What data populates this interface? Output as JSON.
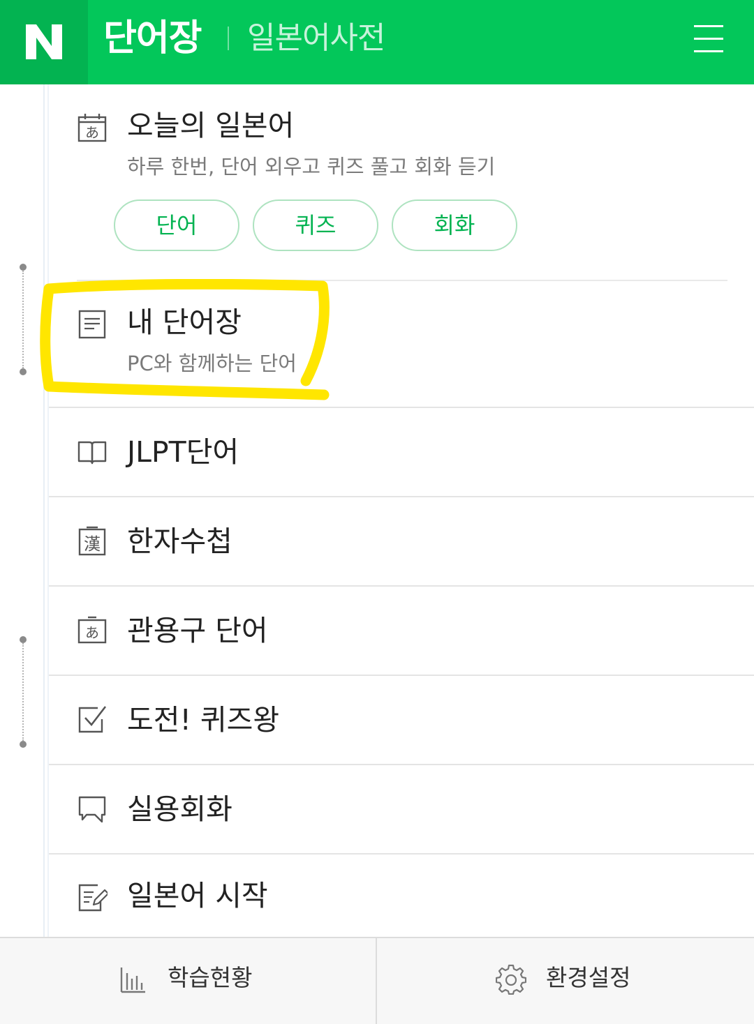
{
  "header": {
    "logo": "N",
    "title": "단어장",
    "subtitle": "일본어사전",
    "menu_icon": "hamburger-menu-icon",
    "background_color": "#03c75a"
  },
  "today": {
    "icon": "calendar-hiragana-icon",
    "icon_glyph": "あ",
    "title": "오늘의 일본어",
    "subtitle": "하루 한번, 단어 외우고 퀴즈 풀고 회화 듣기",
    "buttons": [
      "단어",
      "퀴즈",
      "회화"
    ]
  },
  "menu": [
    {
      "icon": "notebook-icon",
      "label": "내 단어장",
      "subtitle": "PC와 함께하는 단어"
    },
    {
      "icon": "open-book-icon",
      "label": "JLPT단어"
    },
    {
      "icon": "kanji-card-icon",
      "icon_glyph": "漢",
      "label": "한자수첩"
    },
    {
      "icon": "hiragana-card-icon",
      "icon_glyph": "あ",
      "label": "관용구 단어"
    },
    {
      "icon": "checkbox-icon",
      "label": "도전! 퀴즈왕"
    },
    {
      "icon": "speech-bubble-icon",
      "label": "실용회화"
    },
    {
      "icon": "edit-document-icon",
      "label": "일본어 시작"
    }
  ],
  "bottom": {
    "left": {
      "icon": "bar-chart-icon",
      "label": "학습현황"
    },
    "right": {
      "icon": "gear-icon",
      "label": "환경설정"
    }
  },
  "accent_color": "#03c75a",
  "highlight_color": "#ffe600"
}
